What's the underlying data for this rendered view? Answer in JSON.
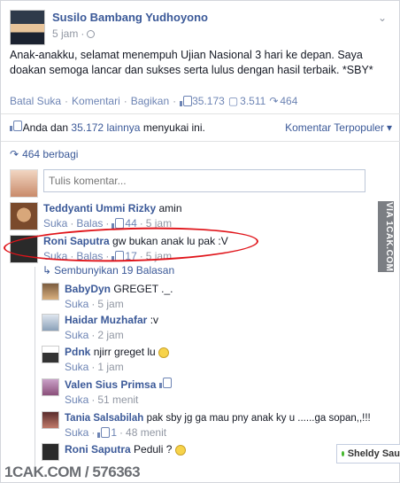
{
  "post": {
    "author": "Susilo Bambang Yudhoyono",
    "time": "5 jam",
    "text": "Anak-anakku, selamat menempuh Ujian Nasional 3 hari ke depan. Saya doakan semoga lancar dan sukses serta lulus dengan hasil terbaik. *SBY*",
    "actions": {
      "unlike": "Batal Suka",
      "comment": "Komentari",
      "share": "Bagikan",
      "likes": "35.173",
      "comments": "3.511",
      "shares": "464"
    }
  },
  "likes_summary": {
    "prefix": "Anda dan",
    "count_link": "35.172 lainnya",
    "suffix": "menyukai ini.",
    "sort_label": "Komentar Terpopuler"
  },
  "shares_summary": "464 berbagi",
  "comment_input": {
    "placeholder": "Tulis komentar..."
  },
  "comments": [
    {
      "name": "Teddyanti Ummi Rizky",
      "text": "amin",
      "like": "Suka",
      "reply": "Balas",
      "likes": "44",
      "time": "5 jam"
    },
    {
      "name": "Roni Saputra",
      "text": "gw bukan anak lu pak :V",
      "like": "Suka",
      "reply": "Balas",
      "likes": "17",
      "time": "5 jam"
    }
  ],
  "hide_replies": "Sembunyikan 19 Balasan",
  "replies": [
    {
      "name": "BabyDyn",
      "text": "GREGET ._.",
      "like": "Suka",
      "time": "5 jam"
    },
    {
      "name": "Haidar Muzhafar",
      "text": ":v",
      "like": "Suka",
      "time": "2 jam"
    },
    {
      "name": "Pdnk",
      "text": "njirr greget lu",
      "like": "Suka",
      "time": "1 jam"
    },
    {
      "name": "Valen Sius Primsa",
      "text": "",
      "like": "Suka",
      "time": "51 menit"
    },
    {
      "name": "Tania Salsabilah",
      "text": "pak sby jg ga mau pny anak ky u ......ga sopan,,!!!",
      "like": "Suka",
      "likes": "1",
      "time": "48 menit"
    },
    {
      "name": "Roni Saputra",
      "text": "Peduli ?",
      "like": "",
      "time": ""
    }
  ],
  "watermark_side": "VIA 1CAK.COM",
  "watermark_bottom": "1CAK.COM / 576363",
  "chat_tab": "Sheldy Sau",
  "colors": {
    "link": "#3b5998",
    "meta": "#9197a3",
    "highlight": "#e0141a"
  }
}
